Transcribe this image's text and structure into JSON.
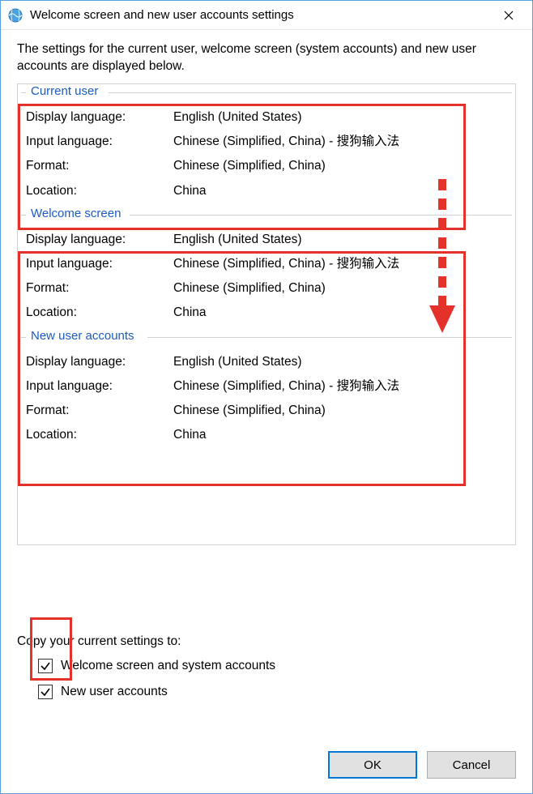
{
  "window": {
    "title": "Welcome screen and new user accounts settings"
  },
  "intro": "The settings for the current user, welcome screen (system accounts) and new user accounts are displayed below.",
  "groups": [
    {
      "legend": "Current user",
      "rows": [
        {
          "label": "Display language:",
          "value": "English (United States)"
        },
        {
          "label": "Input language:",
          "value": "Chinese (Simplified, China) - 搜狗输入法"
        },
        {
          "label": "Format:",
          "value": "Chinese (Simplified, China)"
        },
        {
          "label": "Location:",
          "value": "China"
        }
      ]
    },
    {
      "legend": "Welcome screen",
      "rows": [
        {
          "label": "Display language:",
          "value": "English (United States)"
        },
        {
          "label": "Input language:",
          "value": "Chinese (Simplified, China) - 搜狗输入法"
        },
        {
          "label": "Format:",
          "value": "Chinese (Simplified, China)"
        },
        {
          "label": "Location:",
          "value": "China"
        }
      ]
    },
    {
      "legend": "New user accounts",
      "rows": [
        {
          "label": "Display language:",
          "value": "English (United States)"
        },
        {
          "label": "Input language:",
          "value": "Chinese (Simplified, China) - 搜狗输入法"
        },
        {
          "label": "Format:",
          "value": "Chinese (Simplified, China)"
        },
        {
          "label": "Location:",
          "value": "China"
        }
      ]
    }
  ],
  "copy": {
    "title": "Copy your current settings to:",
    "opt1": "Welcome screen and system accounts",
    "opt2": "New user accounts"
  },
  "buttons": {
    "ok": "OK",
    "cancel": "Cancel"
  }
}
